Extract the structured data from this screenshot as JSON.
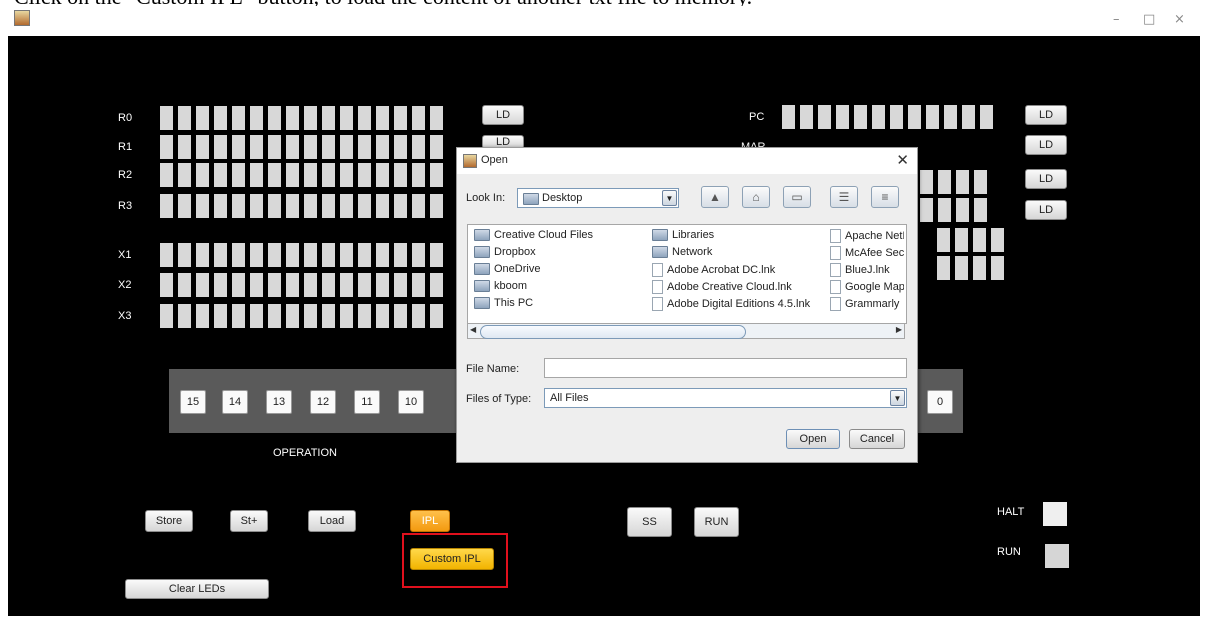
{
  "caption": "Click on the \"Custom IPL\" button, to load the content of another txt file to memory.",
  "window": {
    "minimize_glyph": "–",
    "maximize_glyph": "□",
    "close_glyph": "×"
  },
  "registers_left": [
    {
      "label": "R0",
      "leds": 16
    },
    {
      "label": "R1",
      "leds": 16
    },
    {
      "label": "R2",
      "leds": 16
    },
    {
      "label": "R3",
      "leds": 16
    },
    {
      "label": "X1",
      "leds": 16
    },
    {
      "label": "X2",
      "leds": 16
    },
    {
      "label": "X3",
      "leds": 16
    }
  ],
  "registers_right": [
    {
      "label": "PC"
    },
    {
      "label": "MAR"
    }
  ],
  "ld_label": "LD",
  "op_bits": [
    "15",
    "14",
    "13",
    "12",
    "11",
    "10"
  ],
  "bit_zero": "0",
  "operation_label": "OPERATION",
  "buttons": {
    "store": "Store",
    "st_plus": "St+",
    "load": "Load",
    "ipl": "IPL",
    "custom_ipl": "Custom IPL",
    "clear_leds": "Clear LEDs",
    "ss": "SS",
    "run": "RUN"
  },
  "indicators": {
    "halt": "HALT",
    "run": "RUN"
  },
  "dialog": {
    "title": "Open",
    "look_in_label": "Look In:",
    "look_in_value": "Desktop",
    "file_name_label": "File Name:",
    "file_name_value": "",
    "files_of_type_label": "Files of Type:",
    "files_of_type_value": "All Files",
    "open_button": "Open",
    "cancel_button": "Cancel",
    "files": {
      "col1": [
        {
          "name": "Creative Cloud Files",
          "kind": "folder"
        },
        {
          "name": "Dropbox",
          "kind": "folder"
        },
        {
          "name": "OneDrive",
          "kind": "folder"
        },
        {
          "name": "kboom",
          "kind": "folder"
        },
        {
          "name": "This PC",
          "kind": "folder"
        }
      ],
      "col2": [
        {
          "name": "Libraries",
          "kind": "folder"
        },
        {
          "name": "Network",
          "kind": "folder"
        },
        {
          "name": "Adobe Acrobat DC.lnk",
          "kind": "file"
        },
        {
          "name": "Adobe Creative Cloud.lnk",
          "kind": "file"
        },
        {
          "name": "Adobe Digital Editions 4.5.lnk",
          "kind": "file"
        }
      ],
      "col3": [
        {
          "name": "Apache NetBeans",
          "kind": "file"
        },
        {
          "name": "McAfee Security",
          "kind": "file"
        },
        {
          "name": "BlueJ.lnk",
          "kind": "file"
        },
        {
          "name": "Google Maps",
          "kind": "file"
        },
        {
          "name": "Grammarly",
          "kind": "file"
        }
      ]
    }
  }
}
